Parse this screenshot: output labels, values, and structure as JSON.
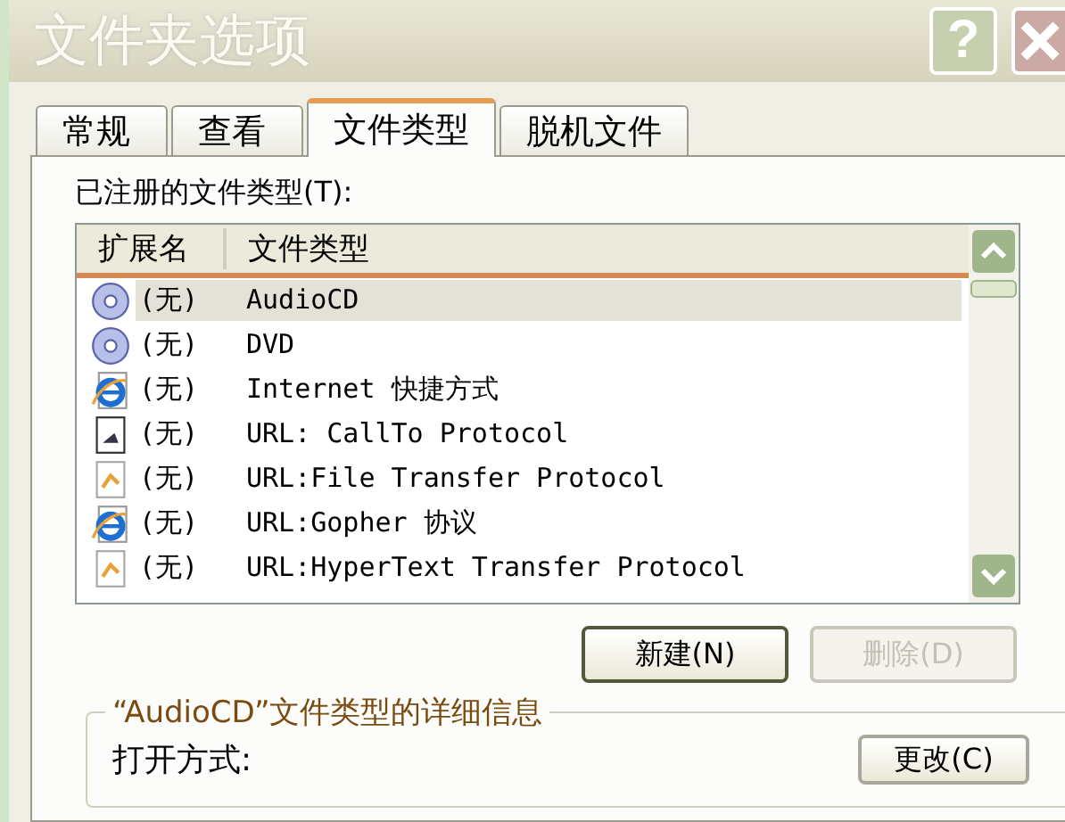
{
  "window": {
    "title": "文件夹选项",
    "help": "?"
  },
  "tabs": [
    {
      "label": "常规",
      "selected": false
    },
    {
      "label": "查看",
      "selected": false
    },
    {
      "label": "文件类型",
      "selected": true
    },
    {
      "label": "脱机文件",
      "selected": false
    }
  ],
  "list_label": "已注册的文件类型(T):",
  "columns": [
    "扩展名",
    "文件类型"
  ],
  "rows": [
    {
      "kind": "disc",
      "extension": "(无)",
      "type": "AudioCD",
      "selected": true
    },
    {
      "kind": "disc",
      "extension": "(无)",
      "type": "DVD",
      "selected": false
    },
    {
      "kind": "web",
      "extension": "(无)",
      "type": "Internet 快捷方式",
      "selected": false
    },
    {
      "kind": "protocol",
      "extension": "(无)",
      "type": "URL: CallTo Protocol",
      "selected": false
    },
    {
      "kind": "transfer",
      "extension": "(无)",
      "type": "URL:File Transfer Protocol",
      "selected": false
    },
    {
      "kind": "web",
      "extension": "(无)",
      "type": "URL:Gopher 协议",
      "selected": false
    },
    {
      "kind": "transfer",
      "extension": "(无)",
      "type": "URL:HyperText Transfer Protocol",
      "selected": false
    }
  ],
  "buttons": [
    {
      "label": "新建(N)",
      "disabled": false
    },
    {
      "label": "删除(D)",
      "disabled": true
    }
  ],
  "details": {
    "legend": "“AudioCD”文件类型的详细信息",
    "open_with": "打开方式:",
    "change_button": "更改(C)"
  }
}
